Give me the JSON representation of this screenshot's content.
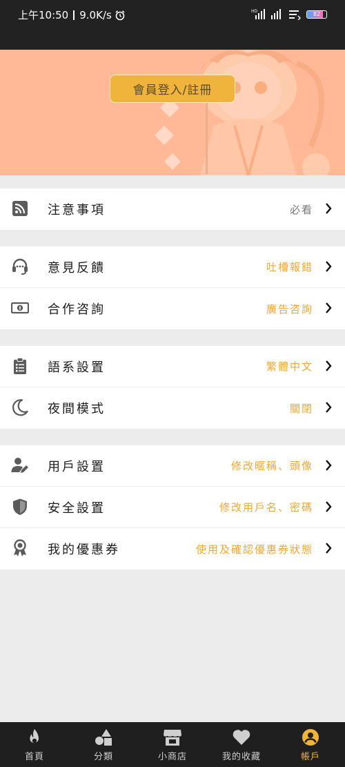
{
  "status_bar": {
    "time": "上午10:50",
    "speed": "9.0K/s",
    "battery": "82"
  },
  "header": {
    "login_label": "會員登入/註冊"
  },
  "menu_groups": [
    {
      "items": [
        {
          "icon": "rss-icon",
          "label": "注意事項",
          "value": "必看",
          "value_style": "gray"
        }
      ]
    },
    {
      "items": [
        {
          "icon": "headset-icon",
          "label": "意見反饋",
          "value": "吐槽報錯",
          "value_style": "accent"
        },
        {
          "icon": "money-icon",
          "label": "合作咨詢",
          "value": "廣告咨詢",
          "value_style": "accent"
        }
      ]
    },
    {
      "items": [
        {
          "icon": "clipboard-icon",
          "label": "語系設置",
          "value": "繁體中文",
          "value_style": "accent"
        },
        {
          "icon": "moon-icon",
          "label": "夜間模式",
          "value": "關閉",
          "value_style": "accent"
        }
      ]
    },
    {
      "items": [
        {
          "icon": "user-edit-icon",
          "label": "用戶設置",
          "value": "修改暱稱、頭像",
          "value_style": "accent"
        },
        {
          "icon": "shield-icon",
          "label": "安全設置",
          "value": "修改用戶名、密碼",
          "value_style": "accent"
        },
        {
          "icon": "award-icon",
          "label": "我的優惠券",
          "value": "使用及確認優惠券狀態",
          "value_style": "accent"
        }
      ]
    }
  ],
  "bottom_nav": [
    {
      "icon": "fire-icon",
      "label": "首頁",
      "active": false
    },
    {
      "icon": "shapes-icon",
      "label": "分類",
      "active": false
    },
    {
      "icon": "store-icon",
      "label": "小商店",
      "active": false
    },
    {
      "icon": "heart-icon",
      "label": "我的收藏",
      "active": false
    },
    {
      "icon": "account-icon",
      "label": "帳戶",
      "active": true
    }
  ],
  "colors": {
    "accent": "#f0a830",
    "header_bg": "#ffb997",
    "status_bg": "#222222",
    "nav_bg": "#1f1f1f"
  }
}
